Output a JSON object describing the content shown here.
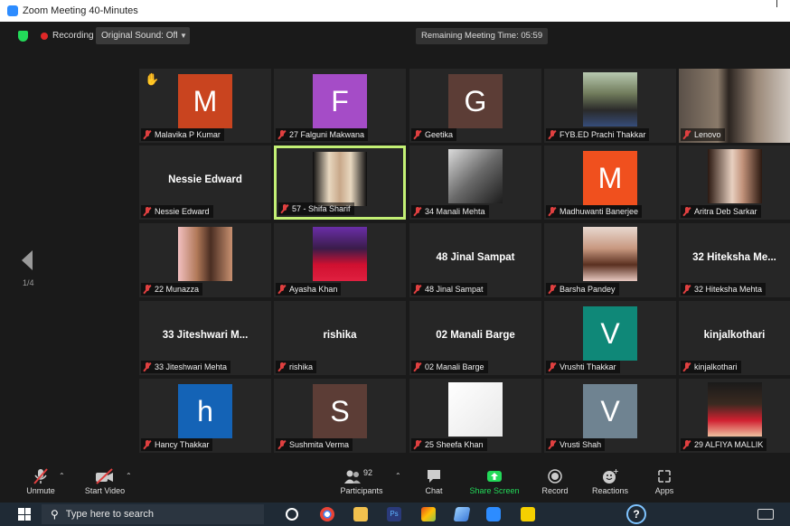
{
  "window": {
    "title": "Zoom Meeting 40-Minutes"
  },
  "topbar": {
    "recording_label": "Recording",
    "original_sound": "Original Sound: Off",
    "remaining_time": "Remaining Meeting Time: 05:59"
  },
  "gallery": {
    "page_indicator": "1/4",
    "tiles": [
      {
        "display": "M",
        "name": "Malavika P Kumar",
        "color": "#c9441f",
        "hand": true
      },
      {
        "display": "F",
        "name": "27 Falguni Makwana",
        "color": "#a54cc7"
      },
      {
        "display": "G",
        "name": "Geetika",
        "color": "#5c3d36"
      },
      {
        "display": "",
        "name": "FYB.ED Prachi Thakkar",
        "photo": "woman-sunglasses"
      },
      {
        "display": "",
        "name": "Lenovo",
        "photo": "woman-indoor-full"
      },
      {
        "display": "Nessie Edward",
        "name": "Nessie Edward"
      },
      {
        "display": "",
        "name": "57 - Shifa Sharif",
        "photo": "woman-hijab",
        "active": true
      },
      {
        "display": "",
        "name": "34 Manali Mehta",
        "photo": "bw-portrait"
      },
      {
        "display": "M",
        "name": "Madhuwanti Banerjee",
        "color": "#f0501e"
      },
      {
        "display": "",
        "name": "Aritra Deb Sarkar",
        "photo": "girl-light"
      },
      {
        "display": "",
        "name": "22 Munazza",
        "photo": "two-women"
      },
      {
        "display": "",
        "name": "Ayasha Khan",
        "photo": "red-scarf"
      },
      {
        "display": "48 Jinal Sampat",
        "name": "48 Jinal Sampat"
      },
      {
        "display": "",
        "name": "Barsha Pandey",
        "photo": "selfie-girl"
      },
      {
        "display": "32 Hiteksha Me...",
        "name": "32 Hiteksha Mehta"
      },
      {
        "display": "33 Jiteshwari M...",
        "name": "33 Jiteshwari Mehta"
      },
      {
        "display": "rishika",
        "name": "rishika"
      },
      {
        "display": "02 Manali Barge",
        "name": "02 Manali Barge"
      },
      {
        "display": "V",
        "name": "Vrushti Thakkar",
        "color": "#0f8878"
      },
      {
        "display": "kinjalkothari",
        "name": "kinjalkothari"
      },
      {
        "display": "h",
        "name": "Hancy Thakkar",
        "color": "#1463b6"
      },
      {
        "display": "S",
        "name": "Sushmita Verma",
        "color": "#5c3d36"
      },
      {
        "display": "",
        "name": "25 Sheefa Khan",
        "photo": "handwritten-note"
      },
      {
        "display": "V",
        "name": "Vrusti Shah",
        "color": "#6f8391"
      },
      {
        "display": "",
        "name": "29 ALFIYA MALLIK",
        "photo": "woman-red-dress"
      }
    ]
  },
  "controls": {
    "unmute": "Unmute",
    "start_video": "Start Video",
    "participants": "Participants",
    "participants_count": "92",
    "chat": "Chat",
    "share_screen": "Share Screen",
    "record": "Record",
    "reactions": "Reactions",
    "apps": "Apps"
  },
  "taskbar": {
    "search_placeholder": "Type here to search",
    "help_glyph": "?"
  },
  "colors": {
    "active_speaker": "#c3f075",
    "share_green": "#23d959",
    "mic_muted": "#e04040"
  }
}
